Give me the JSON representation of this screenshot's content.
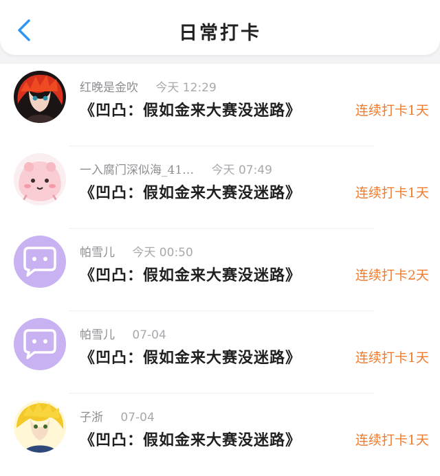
{
  "header": {
    "title": "日常打卡",
    "back_icon": "chevron-left-icon",
    "accent": "#2f95f5"
  },
  "colors": {
    "streak": "#f07b2c",
    "meta_text": "#8e8e93"
  },
  "entries": [
    {
      "name": "红晚是金吹",
      "time": "今天 12:29",
      "checkin": "《凹凸：假如金来大赛没迷路》",
      "streak": "连续打卡1天",
      "avatar": "anime-red-hair-avatar"
    },
    {
      "name": "一入腐门深似海_41…",
      "time": "今天 07:49",
      "checkin": "《凹凸：假如金来大赛没迷路》",
      "streak": "连续打卡1天",
      "avatar": "pink-blob-avatar"
    },
    {
      "name": "帕雪儿",
      "time": "今天 00:50",
      "checkin": "《凹凸：假如金来大赛没迷路》",
      "streak": "连续打卡2天",
      "avatar": "default-chat-avatar"
    },
    {
      "name": "帕雪儿",
      "time": "07-04",
      "checkin": "《凹凸：假如金来大赛没迷路》",
      "streak": "连续打卡1天",
      "avatar": "default-chat-avatar"
    },
    {
      "name": "子浙",
      "time": "07-04",
      "checkin": "《凹凸：假如金来大赛没迷路》",
      "streak": "连续打卡1天",
      "avatar": "anime-yellow-hair-avatar"
    }
  ]
}
